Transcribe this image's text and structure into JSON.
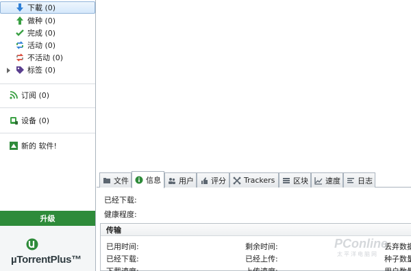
{
  "sidebar": {
    "torrents": [
      {
        "label": "下載 (0)",
        "icon": "download-arrow-icon"
      },
      {
        "label": "做种 (0)",
        "icon": "upload-arrow-icon"
      },
      {
        "label": "完成 (0)",
        "icon": "checkmark-icon"
      },
      {
        "label": "活动 (0)",
        "icon": "active-arrows-icon"
      },
      {
        "label": "不活动 (0)",
        "icon": "inactive-arrows-icon"
      },
      {
        "label": "标签 (0)",
        "icon": "label-tag-icon"
      }
    ],
    "feeds_label": "订阅 (0)",
    "devices_label": "设备 (0)",
    "new_software_label": "新的 软件!",
    "upgrade_label": "升级",
    "promo_logo_text": "µTorrentPlus™",
    "selected_index": 0
  },
  "tabs": [
    {
      "label": "文件",
      "icon": "folder-icon"
    },
    {
      "label": "信息",
      "icon": "info-icon",
      "active": true
    },
    {
      "label": "用户",
      "icon": "peers-icon"
    },
    {
      "label": "评分",
      "icon": "rating-icon"
    },
    {
      "label": "Trackers",
      "icon": "trackers-icon"
    },
    {
      "label": "区块",
      "icon": "pieces-icon"
    },
    {
      "label": "速度",
      "icon": "speed-graph-icon"
    },
    {
      "label": "日志",
      "icon": "log-icon"
    }
  ],
  "info": {
    "downloaded_label": "已经下载:",
    "health_label": "健康程度:"
  },
  "transfer": {
    "heading": "传输",
    "col1": [
      "已用时间:",
      "已经下载:",
      "下載速度:"
    ],
    "col2": [
      "剩余时间:",
      "已经上传:",
      "上传速度:"
    ],
    "col3": [
      "丢弃数据",
      "种子数量",
      "用户数量"
    ]
  },
  "watermark": {
    "text": "PConline",
    "sub": "太平洋电脑网"
  },
  "colors": {
    "accent_green": "#2e8b3a",
    "selected_bg": "#d5e8fb",
    "border": "#a9b3bd"
  }
}
